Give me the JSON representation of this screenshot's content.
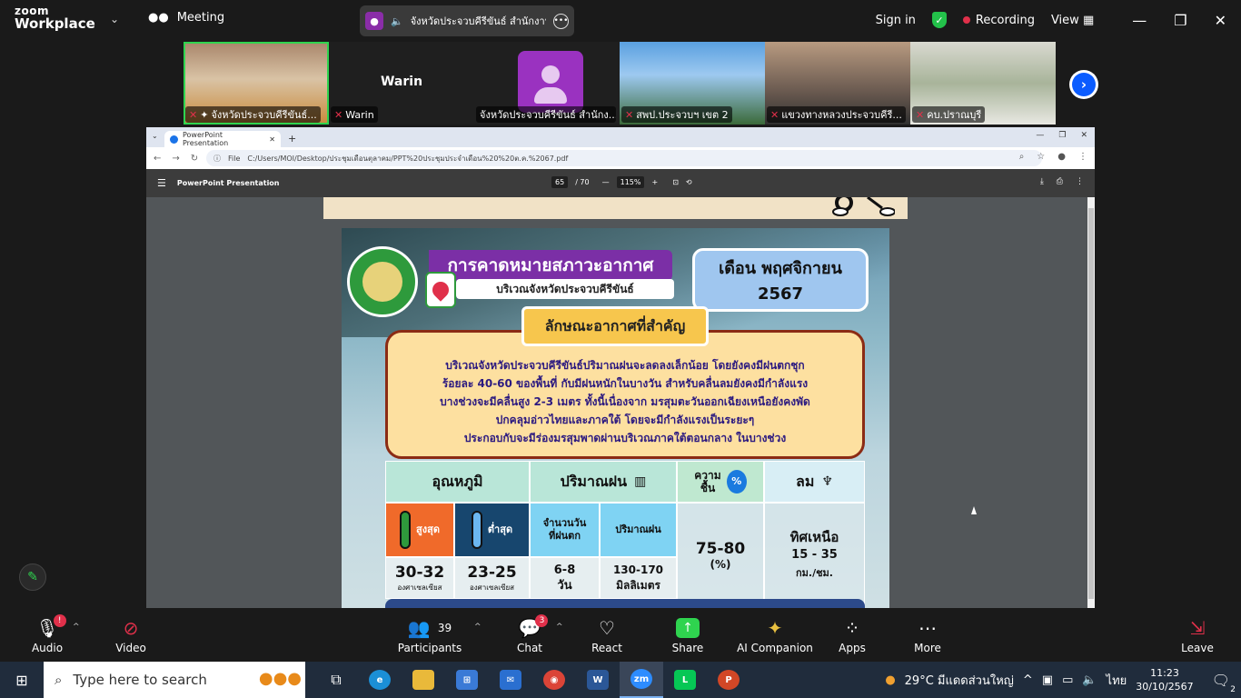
{
  "zoom": {
    "logo_line1": "zoom",
    "logo_line2": "Workplace",
    "meeting_label": "Meeting",
    "share_pill_text": "จังหวัดประจวบคีรีขันธ์ สำนักงานจั",
    "sign_in": "Sign in",
    "recording": "Recording",
    "view": "View",
    "accent_green": "#2fd44f",
    "record_red": "#e0304a"
  },
  "participants": [
    {
      "name": "จังหวัดประจวบคีรีขันธ์..."
    },
    {
      "name": "Warin",
      "big_name": "Warin"
    },
    {
      "name": "จังหวัดประจวบคีรีขันธ์ สำนักง..."
    },
    {
      "name": "สพป.ประจวบฯ เขต 2"
    },
    {
      "name": "แขวงทางหลวงประจวบคีรี..."
    },
    {
      "name": "คบ.ปราณบุรี"
    }
  ],
  "browser": {
    "tab_title": "PowerPoint Presentation",
    "file_label": "File",
    "url": "C:/Users/MOI/Desktop/ประชุมเดือนตุลาคม/PPT%20ประชุมประจำเดือน%20%20ต.ค.%2067.pdf",
    "pdf_title": "PowerPoint Presentation",
    "page_current": "65",
    "page_total": "/ 70",
    "zoom_level": "115%"
  },
  "slide": {
    "title": "การคาดหมายสภาวะอากาศ",
    "subtitle": "บริเวณจังหวัดประจวบคีรีขันธ์",
    "month_line1": "เดือน พฤศจิกายน",
    "month_line2": "2567",
    "features_title": "ลักษณะอากาศที่สำคัญ",
    "description_lines": [
      "บริเวณจังหวัดประจวบคีรีขันธ์ปริมาณฝนจะลดลงเล็กน้อย โดยยังคงมีฝนตกชุก",
      "ร้อยละ 40-60 ของพื้นที่ กับมีฝนหนักในบางวัน สำหรับคลื่นลมยังคงมีกำลังแรง",
      "บางช่วงจะมีคลื่นสูง 2-3 เมตร ทั้งนี้เนื่องจาก มรสุมตะวันออกเฉียงเหนือยังคงพัด",
      "ปกคลุมอ่าวไทยและภาคใต้ โดยจะมีกำลังแรงเป็นระยะๆ",
      "ประกอบกับจะมีร่องมรสุมพาดผ่านบริเวณภาคใต้ตอนกลาง ในบางช่วง"
    ],
    "table": {
      "temp_header": "อุณหภูมิ",
      "rain_header": "ปริมาณฝน",
      "humidity_header_1": "ความ",
      "humidity_header_2": "ชื้น",
      "wind_header": "ลม",
      "max_label": "สูงสุด",
      "min_label": "ต่ำสุด",
      "rain_days_label_1": "จำนวนวัน",
      "rain_days_label_2": "ที่ฝนตก",
      "rain_amount_label": "ปริมาณฝน",
      "max_value": "30-32",
      "max_unit": "องศาเซลเซียส",
      "min_value": "23-25",
      "min_unit": "องศาเซลเซียส",
      "rain_days_value": "6-8",
      "rain_days_unit": "วัน",
      "rain_amount_value": "130-170",
      "rain_amount_unit": "มิลลิเมตร",
      "humidity_value": "75-80",
      "humidity_unit": "(%)",
      "wind_dir": "ทิศเหนือ",
      "wind_speed": "15 - 35",
      "wind_unit": "กม./ชม."
    }
  },
  "toolbar": {
    "audio": "Audio",
    "audio_badge": "!",
    "video": "Video",
    "participants": "Participants",
    "participants_count": "39",
    "chat": "Chat",
    "chat_badge": "3",
    "react": "React",
    "share": "Share",
    "ai": "AI Companion",
    "apps": "Apps",
    "more": "More",
    "leave": "Leave"
  },
  "taskbar": {
    "search_placeholder": "Type here to search",
    "weather": "29°C มีแดดส่วนใหญ่",
    "lang": "ไทย",
    "time": "11:23",
    "date": "30/10/2567",
    "notif_count": "2"
  }
}
